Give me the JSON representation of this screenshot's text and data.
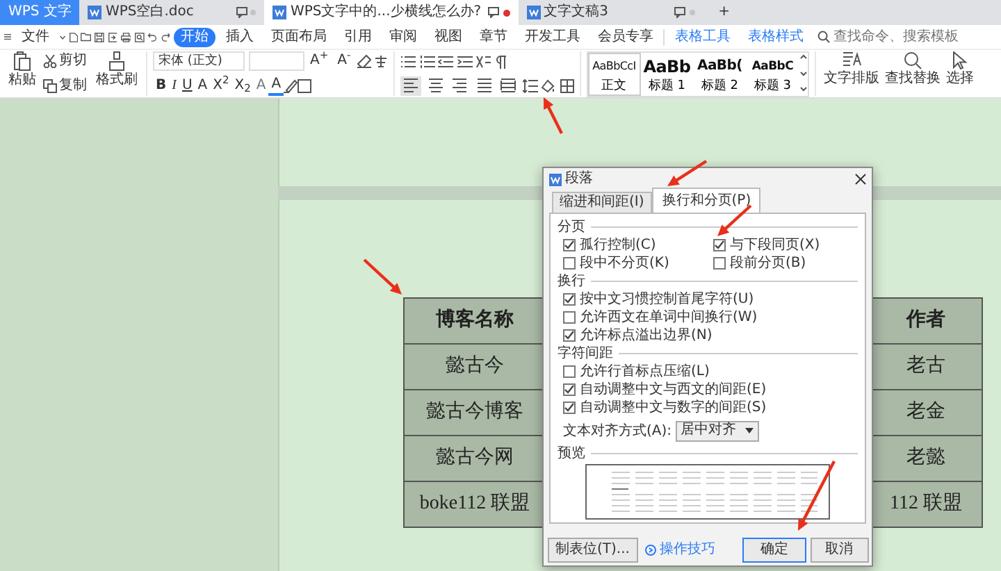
{
  "app_tabs": [
    {
      "label": "WPS 文字",
      "kind": "home",
      "selected": false
    },
    {
      "label": "WPS空白.doc",
      "kind": "doc",
      "selected": false,
      "unsaved": false
    },
    {
      "label": "WPS文字中的...少横线怎么办?",
      "kind": "doc",
      "selected": true,
      "unsaved": true
    },
    {
      "label": "文字文稿3",
      "kind": "doc",
      "selected": false,
      "unsaved": false
    }
  ],
  "new_tab": "+",
  "menu": {
    "file": "文件",
    "items": [
      {
        "label": "开始",
        "selected": true
      },
      {
        "label": "插入",
        "selected": false
      },
      {
        "label": "页面布局",
        "selected": false
      },
      {
        "label": "引用",
        "selected": false
      },
      {
        "label": "审阅",
        "selected": false
      },
      {
        "label": "视图",
        "selected": false
      },
      {
        "label": "章节",
        "selected": false
      },
      {
        "label": "开发工具",
        "selected": false
      },
      {
        "label": "会员专享",
        "selected": false
      }
    ],
    "context_items": [
      {
        "label": "表格工具",
        "selected": false
      },
      {
        "label": "表格样式",
        "selected": false
      }
    ],
    "search": {
      "placeholder": "查找命令、搜索模板"
    }
  },
  "ribbon": {
    "paste": "粘贴",
    "cut": "剪切",
    "copy": "复制",
    "format_painter": "格式刷",
    "font": {
      "value": "宋体 (正文)"
    },
    "size_buttons": [
      {
        "label": "A$^{+}$"
      },
      {
        "label": "A$^{-}$"
      }
    ],
    "font_buttons": [
      {
        "label": "B",
        "kind": "bold"
      },
      {
        "label": "I",
        "kind": "italic"
      },
      {
        "label": "U",
        "kind": "underline"
      },
      {
        "label": "A",
        "kind": "plain"
      },
      {
        "label": "X$^{2}$",
        "kind": "plain"
      },
      {
        "label": "X$_{2}$",
        "kind": "plain"
      },
      {
        "label": "A",
        "kind": "outline"
      },
      {
        "label": "A",
        "kind": "color"
      }
    ],
    "alignment": [
      {
        "kind": "left",
        "selected": true
      },
      {
        "kind": "center",
        "selected": false
      },
      {
        "kind": "right",
        "selected": false
      },
      {
        "kind": "justify",
        "selected": false
      },
      {
        "kind": "distributed",
        "selected": false
      }
    ],
    "styles": [
      {
        "preview": "AaBbCcI",
        "label": "正文",
        "kind": "body",
        "selected": true
      },
      {
        "preview": "AaBb",
        "label": "标题 1",
        "kind": "h1",
        "selected": false
      },
      {
        "preview": "AaBb(",
        "label": "标题 2",
        "kind": "h2",
        "selected": false
      },
      {
        "preview": "AaBbC",
        "label": "标题 3",
        "kind": "h3",
        "selected": false
      }
    ],
    "tools": [
      {
        "label": "文字排版",
        "kind": "layout"
      },
      {
        "label": "查找替换",
        "kind": "find"
      },
      {
        "label": "选择",
        "kind": "select"
      }
    ]
  },
  "table": {
    "rows": [
      {
        "header": true,
        "cells": [
          "博客名称",
          "作者"
        ]
      },
      {
        "header": false,
        "cells": [
          "懿古今",
          "老古"
        ]
      },
      {
        "header": false,
        "cells": [
          "懿古今博客",
          "老金"
        ]
      },
      {
        "header": false,
        "cells": [
          "懿古今网",
          "老懿"
        ]
      },
      {
        "header": false,
        "cells": [
          "boke112 联盟",
          "112 联盟"
        ]
      }
    ]
  },
  "dialog": {
    "title": "段落",
    "tabs": [
      {
        "label": "缩进和间距(I)",
        "selected": false
      },
      {
        "label": "换行和分页(P)",
        "selected": true
      }
    ],
    "sections": [
      {
        "title": "分页",
        "kind": "grid",
        "options": [
          {
            "label": "孤行控制(C)",
            "checked": true
          },
          {
            "label": "与下段同页(X)",
            "checked": true
          },
          {
            "label": "段中不分页(K)",
            "checked": false
          },
          {
            "label": "段前分页(B)",
            "checked": false
          }
        ]
      },
      {
        "title": "换行",
        "kind": "list",
        "options": [
          {
            "label": "按中文习惯控制首尾字符(U)",
            "checked": true
          },
          {
            "label": "允许西文在单词中间换行(W)",
            "checked": false
          },
          {
            "label": "允许标点溢出边界(N)",
            "checked": true
          }
        ]
      },
      {
        "title": "字符间距",
        "kind": "list",
        "options": [
          {
            "label": "允许行首标点压缩(L)",
            "checked": false
          },
          {
            "label": "自动调整中文与西文的间距(E)",
            "checked": true
          },
          {
            "label": "自动调整中文与数字的间距(S)",
            "checked": true
          }
        ]
      }
    ],
    "alignment": {
      "label": "文本对齐方式(A):",
      "value": "居中对齐"
    },
    "preview": {
      "title": "预览"
    },
    "buttons": [
      {
        "label": "制表位(T)...",
        "kind": "plain"
      },
      {
        "label": "操作技巧",
        "kind": "link"
      },
      {
        "label": "确定",
        "kind": "default"
      },
      {
        "label": "取消",
        "kind": "plain"
      }
    ]
  }
}
